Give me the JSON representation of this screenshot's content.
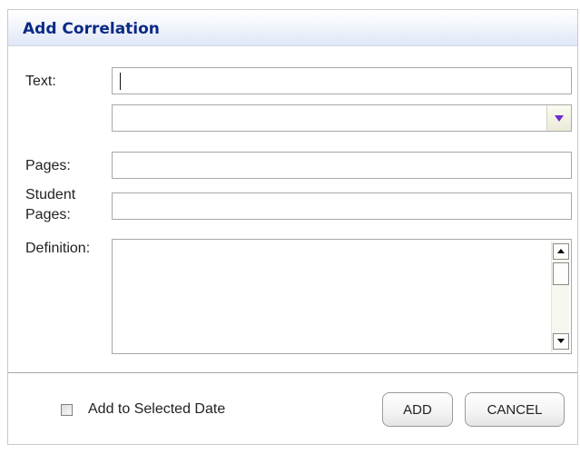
{
  "dialog": {
    "title": "Add Correlation"
  },
  "form": {
    "text_label": "Text:",
    "text_value": "",
    "dropdown_value": "",
    "pages_label": "Pages:",
    "pages_value": "",
    "student_pages_label_line1": "Student",
    "student_pages_label_line2": "Pages:",
    "student_pages_value": "",
    "definition_label": "Definition:",
    "definition_value": ""
  },
  "footer": {
    "checkbox_label": "Add to Selected Date",
    "checkbox_checked": false,
    "add_label": "ADD",
    "cancel_label": "CANCEL"
  },
  "icons": {
    "dropdown": "chevron-down-icon",
    "scroll_up": "arrow-up-icon",
    "scroll_down": "arrow-down-icon"
  },
  "colors": {
    "title_text": "#0a2a86",
    "title_gradient_end": "#dfe7f7",
    "dropdown_arrow": "#6a2fd1"
  }
}
